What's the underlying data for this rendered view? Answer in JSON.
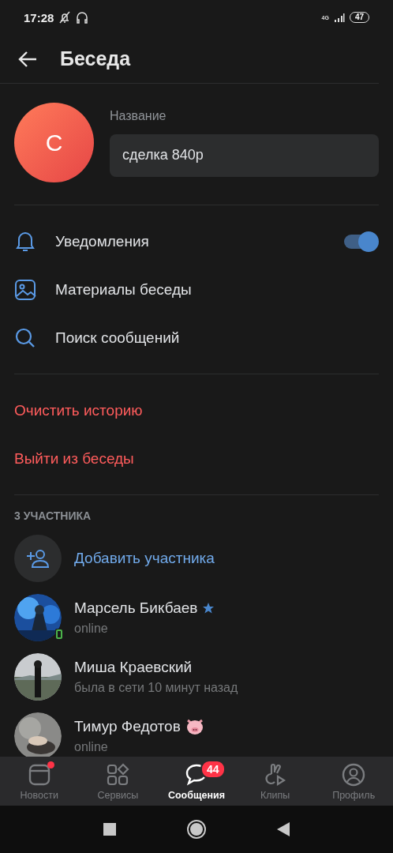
{
  "status_bar": {
    "time": "17:28",
    "network": "4G",
    "battery": "47"
  },
  "header": {
    "title": "Беседа"
  },
  "chat": {
    "avatar_letter": "С",
    "name_label": "Название",
    "name_value": "сделка 840р"
  },
  "settings": [
    {
      "kind": "toggle",
      "label": "Уведомления",
      "on": true
    },
    {
      "kind": "link",
      "label": "Материалы беседы"
    },
    {
      "kind": "link",
      "label": "Поиск сообщений"
    }
  ],
  "actions": [
    "Очистить историю",
    "Выйти из беседы"
  ],
  "members_header": "3 УЧАСТНИКА",
  "add_member": "Добавить участника",
  "members": [
    {
      "kind": "verified",
      "name": "Марсель Бикбаев",
      "status": "online",
      "mobile": true
    },
    {
      "kind": "plain",
      "name": "Миша Краевский",
      "status": "была в сети 10 минут назад",
      "mobile": false
    },
    {
      "kind": "emoji",
      "name": "Тимур Федотов",
      "status": "online",
      "mobile": false
    }
  ],
  "tabs": [
    {
      "label": "Новости",
      "selected": false,
      "dot": true
    },
    {
      "label": "Сервисы",
      "selected": false,
      "dot": false
    },
    {
      "label": "Сообщения",
      "selected": true,
      "dot": false,
      "badge": "44"
    },
    {
      "label": "Клипы",
      "selected": false,
      "dot": false
    },
    {
      "label": "Профиль",
      "selected": false,
      "dot": false
    }
  ]
}
